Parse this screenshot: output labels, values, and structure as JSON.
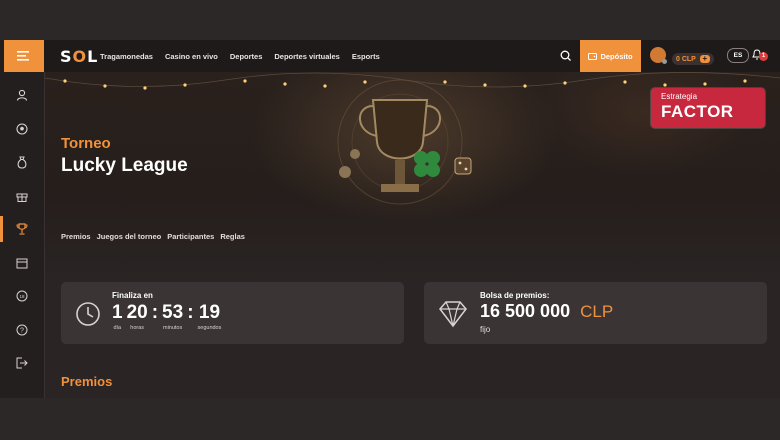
{
  "header": {
    "logo_text": "S",
    "logo_text_o": "O",
    "logo_text_end": "L",
    "nav": [
      "Tragamonedas",
      "Casino en vivo",
      "Deportes",
      "Deportes virtuales",
      "Esports"
    ],
    "deposit_label": "Depósito",
    "balance": "0 CLP",
    "balance_add": "+",
    "language": "ES",
    "notifications_count": "1"
  },
  "sidebar": {
    "items": [
      "menu-icon",
      "user-icon",
      "football-icon",
      "money-bag-icon",
      "gift-icon",
      "trophy-icon",
      "calendar-icon",
      "support-18-icon",
      "help-icon",
      "logout-icon"
    ],
    "active": "trophy-icon"
  },
  "hero": {
    "subtitle": "Torneo",
    "title": "Lucky League",
    "promo_small": "Estrategia",
    "promo_big": "FACTOR",
    "tabs": [
      "Premios",
      "Juegos del torneo",
      "Participantes",
      "Reglas"
    ]
  },
  "timer": {
    "label": "Finaliza en",
    "days": "1",
    "hours": "20",
    "minutes": "53",
    "seconds": "19",
    "days_label": "día",
    "hours_label": "horas",
    "minutes_label": "minutos",
    "seconds_label": "segundos"
  },
  "prize_pool": {
    "label": "Bolsa de premios:",
    "amount": "16 500 000",
    "currency": "CLP",
    "note": "fijo"
  },
  "section": {
    "title": "Premios"
  },
  "colors": {
    "accent": "#f0913b",
    "promo": "#c8283e",
    "background": "#2a2424",
    "card": "#3b3434"
  }
}
